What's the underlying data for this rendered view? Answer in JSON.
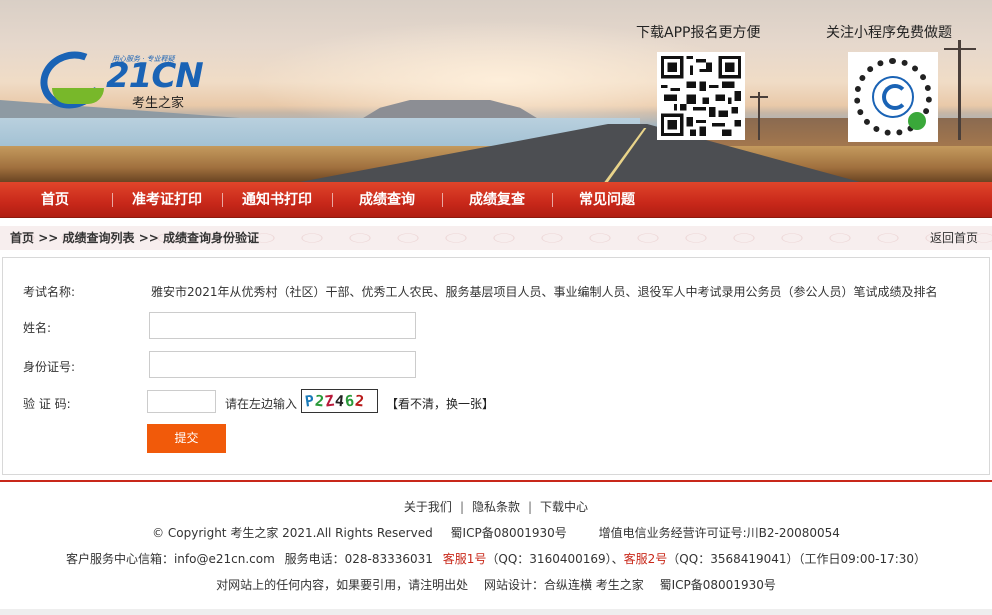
{
  "banner": {
    "logo_text": "21CN",
    "logo_slogan": "用心服务 · 专业释疑",
    "logo_sub": "考生之家",
    "qr_app_title": "下载APP报名更方便",
    "qr_mini_title": "关注小程序免费做题"
  },
  "nav": {
    "items": [
      "首页",
      "准考证打印",
      "通知书打印",
      "成绩查询",
      "成绩复查",
      "常见问题"
    ]
  },
  "breadcrumb": {
    "home": "首页",
    "sep": ">>",
    "list": "成绩查询列表",
    "current": "成绩查询身份验证",
    "back": "返回首页"
  },
  "form": {
    "exam_label": "考试名称:",
    "exam_name": "雅安市2021年从优秀村（社区）干部、优秀工人农民、服务基层项目人员、事业编制人员、退役军人中考试录用公务员（参公人员）笔试成绩及排名",
    "name_label": "姓名:",
    "name_value": "",
    "id_label": "身份证号:",
    "id_value": "",
    "captcha_label": "验 证 码:",
    "captcha_value": "",
    "captcha_hint": "请在左边输入",
    "captcha_chars": [
      "P",
      "2",
      "Z",
      "4",
      "6",
      "2"
    ],
    "captcha_colors": [
      "#1a7ab8",
      "#2a9a3a",
      "#b81a3a",
      "#222222",
      "#2a9a3a",
      "#b81a1a"
    ],
    "refresh_text": "【看不清，换一张】",
    "submit_label": "提交"
  },
  "footer": {
    "links": [
      "关于我们",
      "隐私条款",
      "下载中心"
    ],
    "copyright": "© Copyright 考生之家 2021.All Rights Reserved",
    "icp": "蜀ICP备08001930号",
    "license": "增值电信业务经营许可证号:川B2-20080054",
    "service_mail_label": "客户服务中心信箱：",
    "service_mail": "info@e21cn.com",
    "service_phone": "服务电话：028-83336031",
    "kefu1": "客服1号",
    "kefu1_qq": "（QQ：3160400169）、",
    "kefu2": "客服2号",
    "kefu2_qq": "（QQ：3568419041）（工作日09:00-17:30）",
    "notice": "对网站上的任何内容，如果要引用，请注明出处",
    "design": "网站设计：合纵连横 考生之家",
    "icp2": "蜀ICP备08001930号"
  },
  "colors": {
    "nav_red": "#c8281a",
    "submit_orange": "#f15a0a",
    "logo_blue": "#1a63b5",
    "logo_green": "#78b82a"
  }
}
